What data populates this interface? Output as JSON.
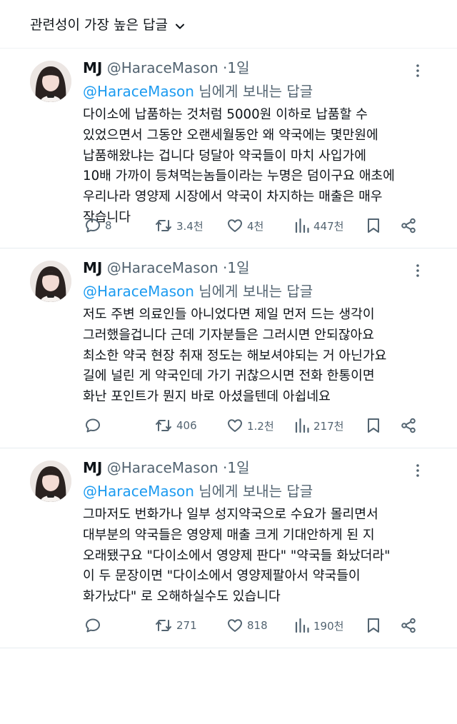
{
  "sort": {
    "label": "관련성이 가장 높은 답글"
  },
  "tweets": [
    {
      "name": "MJ",
      "handle": "@HaraceMason",
      "dot": "·",
      "time": "1일",
      "reply_mention": "@HaraceMason",
      "reply_suffix": "님에게 보내는 답글",
      "body": "다이소에 납품하는 것처럼 5000원 이하로 납품할 수\n있었으면서  그동안 오랜세월동안 왜 약국에는 몇만원에\n납품해왔냐는 겁니다  덩달아 약국들이 마치 사입가에\n10배 가까이 등쳐먹는놈들이라는 누명은 덤이구요  애초에\n우리나라 영양제 시장에서 약국이 차지하는 매출은 매우\n작습니다",
      "replies": "8",
      "retweets": "3.4천",
      "likes": "4천",
      "views": "447천"
    },
    {
      "name": "MJ",
      "handle": "@HaraceMason",
      "dot": "·",
      "time": "1일",
      "reply_mention": "@HaraceMason",
      "reply_suffix": "님에게 보내는 답글",
      "body": "저도 주변 의료인들 아니었다면 제일 먼저 드는 생각이\n그러했을겁니다  근데 기자분들은 그러시면 안되잖아요\n최소한 약국 현장 취재 정도는 해보셔야되는 거 아닌가요\n길에 널린 게 약국인데 가기 귀찮으시면 전화 한통이면\n화난 포인트가 뭔지 바로 아셨을텐데 아쉽네요",
      "replies": "",
      "retweets": "406",
      "likes": "1.2천",
      "views": "217천"
    },
    {
      "name": "MJ",
      "handle": "@HaraceMason",
      "dot": "·",
      "time": "1일",
      "reply_mention": "@HaraceMason",
      "reply_suffix": "님에게 보내는 답글",
      "body": "그마저도 번화가나 일부 성지약국으로 수요가 몰리면서\n대부분의 약국들은 영양제 매출 크게 기대안하게 된 지\n오래됐구요  \"다이소에서 영양제 판다\" \"약국들 화났더라\"\n이 두 문장이면 \"다이소에서 영양제팔아서 약국들이\n화가났다\" 로 오해하실수도 있습니다",
      "replies": "",
      "retweets": "271",
      "likes": "818",
      "views": "190천"
    }
  ],
  "icons": {
    "sort": "chevron-down-icon",
    "more": "more-dots-icon",
    "reply": "reply-bubble-icon",
    "retweet": "retweet-icon",
    "like": "heart-icon",
    "views": "views-bars-icon",
    "bookmark": "bookmark-icon",
    "share": "share-icon"
  },
  "colors": {
    "text": "#0f1419",
    "muted": "#536471",
    "link": "#1d9bf0",
    "divider": "#e6ecf0"
  }
}
